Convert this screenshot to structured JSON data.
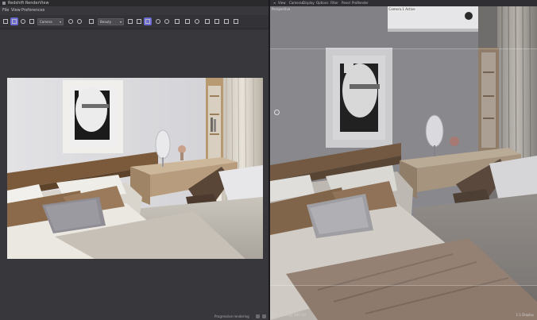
{
  "left_window": {
    "title": "Redshift RenderView",
    "menu": [
      "File",
      "View",
      "Preferences"
    ],
    "toolbar": {
      "camera_dropdown": "Camera",
      "aov_dropdown": "Beauty"
    },
    "status": "Progressive rendering"
  },
  "viewport": {
    "menu": [
      "View",
      "Cameras",
      "Display",
      "Options",
      "Filter",
      "Panel",
      "ProRender"
    ],
    "label": "Perspective",
    "camera_tab": "Camera.1 Active",
    "bottom_left": "Grid Spacing: 100 cm",
    "bottom_right": "1:1 Display"
  },
  "colors": {
    "accent": "#6a6ad0",
    "panel": "#38383c",
    "viewport_bg": "#7a7a80"
  }
}
